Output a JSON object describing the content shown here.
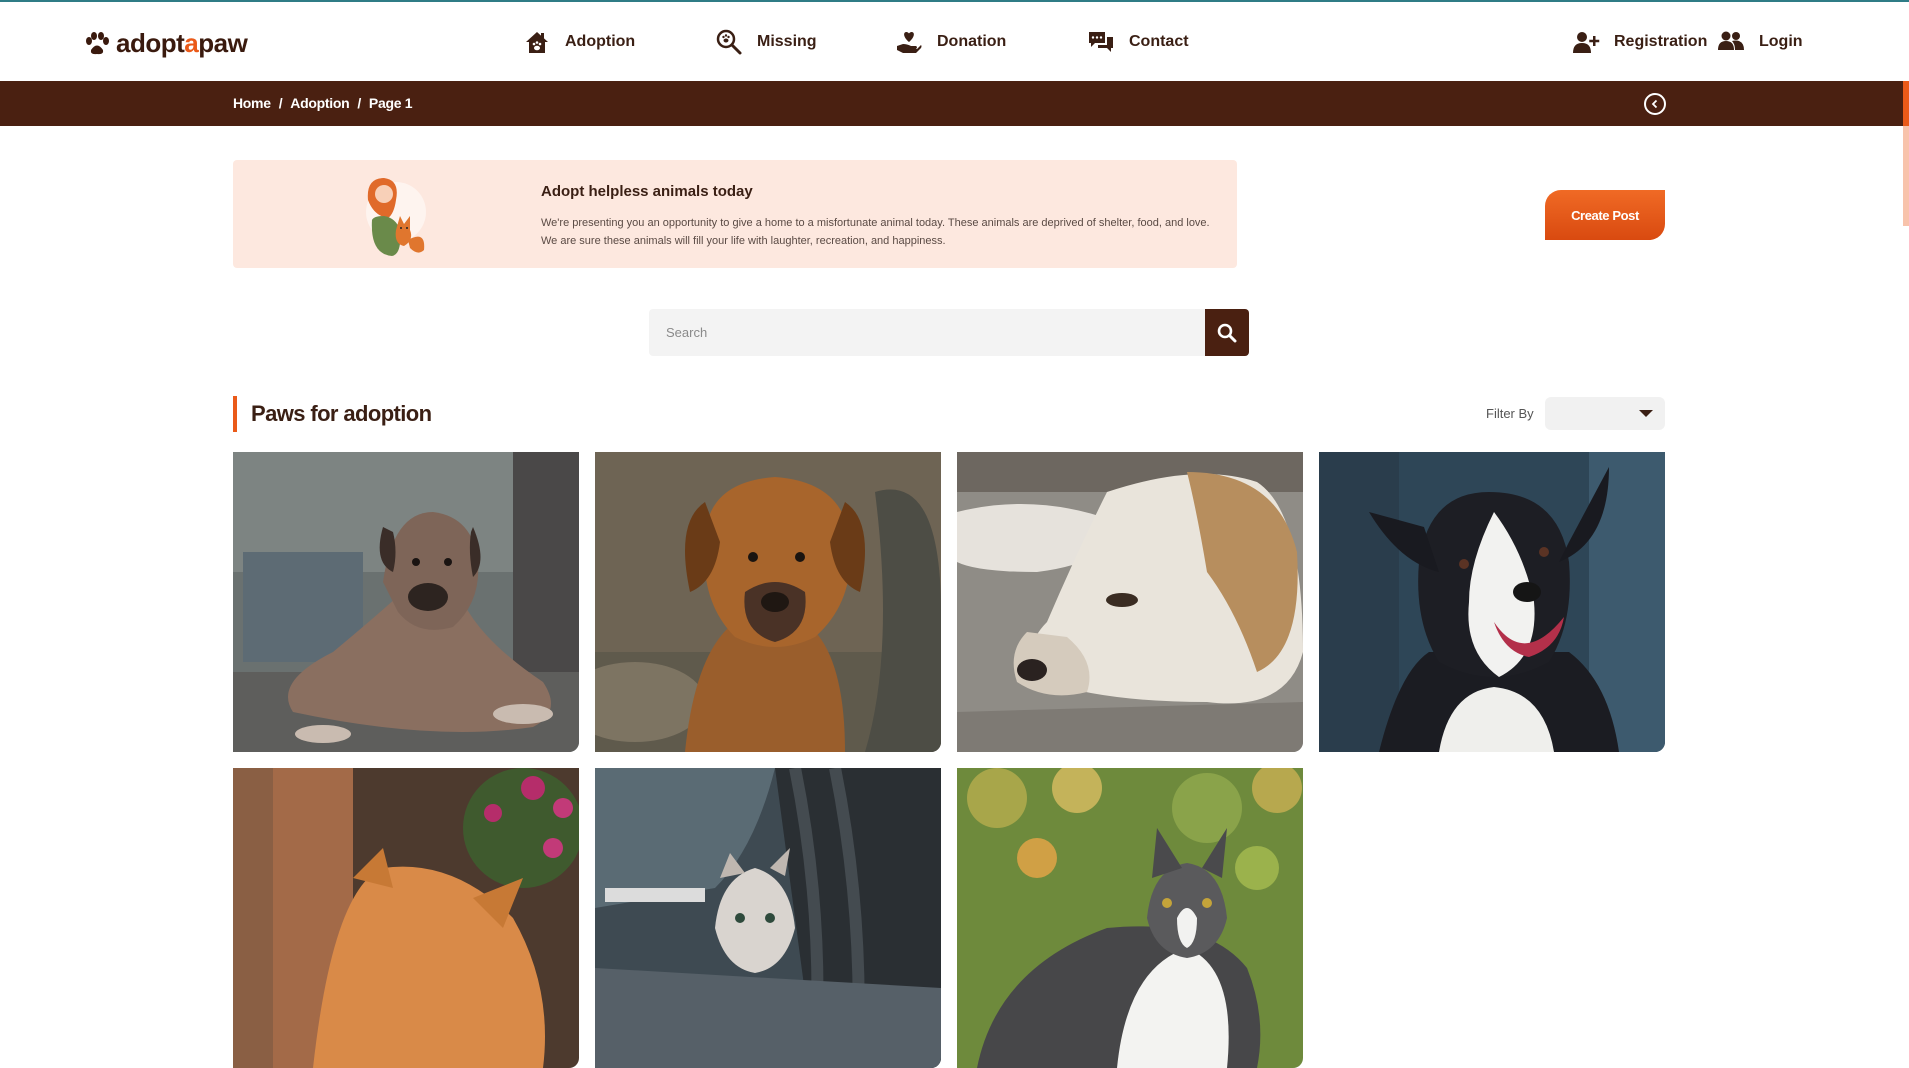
{
  "brand": {
    "prefix": "adopt",
    "accent": "a",
    "suffix": "paw",
    "accent_color": "#ea5a19"
  },
  "nav": {
    "adoption": "Adoption",
    "missing": "Missing",
    "donation": "Donation",
    "contact": "Contact",
    "registration": "Registration",
    "login": "Login"
  },
  "breadcrumb": {
    "home": "Home",
    "adoption": "Adoption",
    "page": "Page 1",
    "separator": "/"
  },
  "banner": {
    "title": "Adopt helpless animals today",
    "text": "We're presenting you an opportunity to give a home to a misfortunate animal today. These animals are deprived of shelter, food, and love. We are sure these animals will fill your life with laughter, recreation, and happiness."
  },
  "create_post_label": "Create Post",
  "search": {
    "placeholder": "Search"
  },
  "section": {
    "title": "Paws for adoption"
  },
  "filter": {
    "label": "Filter By",
    "selected": ""
  },
  "cards": [
    {
      "animal": "dog",
      "description": "dog lying on pavement"
    },
    {
      "animal": "dog",
      "description": "brown puppy on ground"
    },
    {
      "animal": "dog",
      "description": "dog resting head close-up"
    },
    {
      "animal": "dog",
      "description": "black and white border collie"
    },
    {
      "animal": "cat",
      "description": "orange cat with flowers"
    },
    {
      "animal": "cat",
      "description": "kitten near tire"
    },
    {
      "animal": "cat",
      "description": "tricolor cat in grass"
    }
  ],
  "colors": {
    "brown": "#4a2011",
    "orange": "#ea5a19",
    "banner_bg": "#fde8df"
  }
}
